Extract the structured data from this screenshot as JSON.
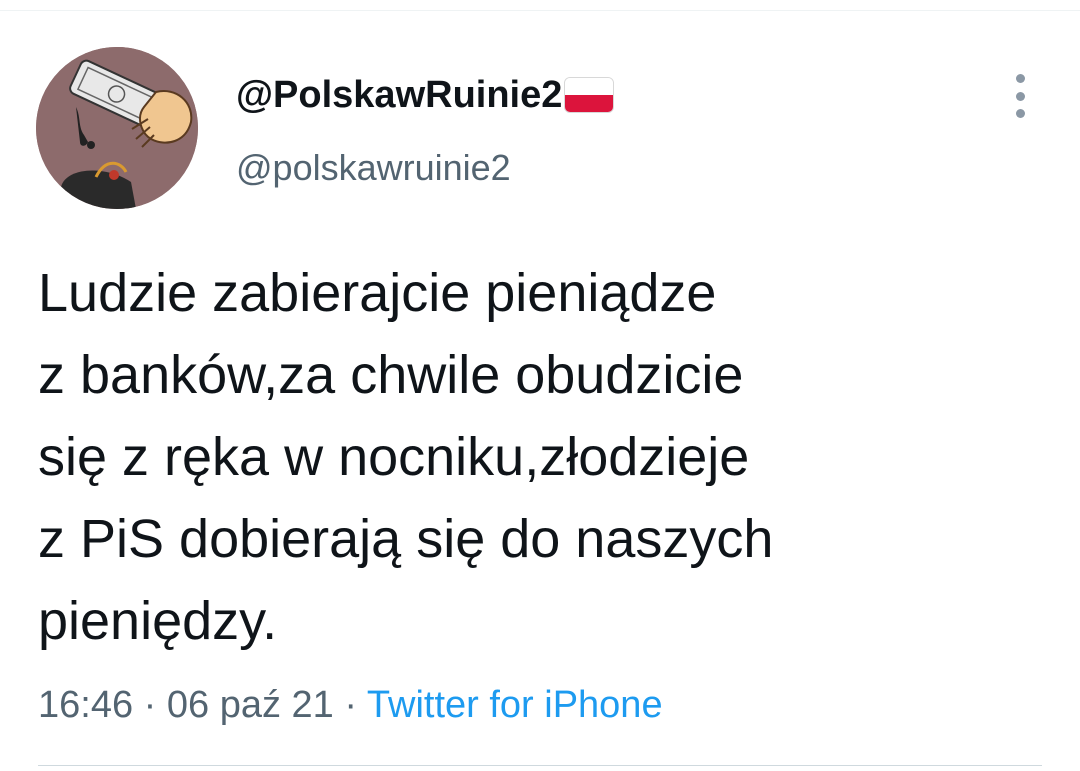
{
  "user": {
    "display_name": "@PolskawRuinie2",
    "handle": "@polskawruinie2",
    "flag": "poland-flag-icon",
    "avatar": "avatar-cartoon-hand-money"
  },
  "tweet": {
    "lines": [
      "Ludzie zabierajcie pieniądze",
      "z banków,za chwile obudzicie",
      "się z ręka w nocniku,złodzieje",
      "z PiS dobierają się do naszych",
      "pieniędzy."
    ],
    "time": "16:46",
    "separator": "·",
    "date": "06 paź 21",
    "source": "Twitter for iPhone"
  },
  "menu": {
    "icon": "more-vertical-icon"
  },
  "colors": {
    "text": "#0f1419",
    "secondary": "#536471",
    "link": "#1d9bf0",
    "flag_red": "#dc143c",
    "avatar_bg": "#8d6b6c"
  }
}
